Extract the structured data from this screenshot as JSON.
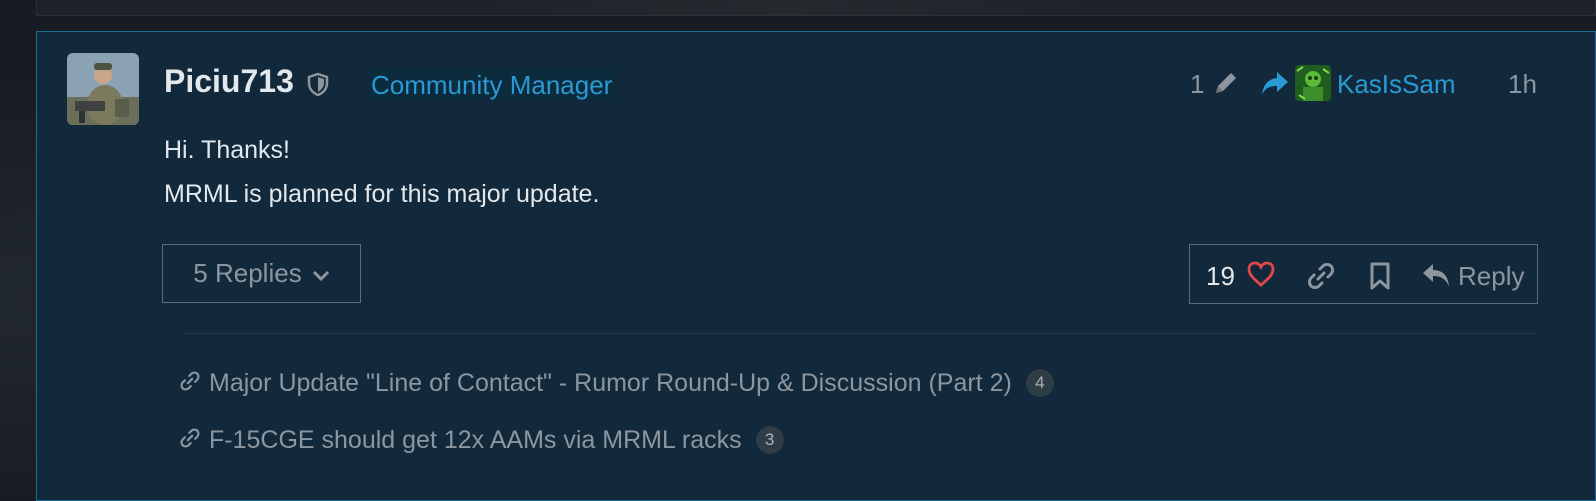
{
  "post": {
    "username": "Piciu713",
    "user_title": "Community Manager",
    "edit_count": "1",
    "reply_to_user": "KasIsSam",
    "age": "1h",
    "body": [
      "Hi. Thanks!",
      "MRML is planned for this major update."
    ],
    "replies_label": "5 Replies",
    "like_count": "19",
    "reply_label": "Reply"
  },
  "linked_topics": [
    {
      "title": "Major Update \"Line of Contact\" - Rumor Round-Up & Discussion (Part 2)",
      "count": "4"
    },
    {
      "title": "F-15CGE should get 12x AAMs via MRML racks",
      "count": "3"
    }
  ],
  "colors": {
    "accent": "#2a9ad4",
    "post_bg": "#11293a",
    "like_heart": "#e0484a",
    "muted_text": "#8d969e"
  },
  "icons": {
    "moderator": "shield-icon",
    "edit": "pencil-icon",
    "reply_to": "share-arrow-icon",
    "replies_toggle": "chevron-down-icon",
    "like": "heart-icon",
    "share": "link-icon",
    "bookmark": "bookmark-icon",
    "reply": "reply-arrow-icon",
    "topic_link": "link-icon"
  }
}
